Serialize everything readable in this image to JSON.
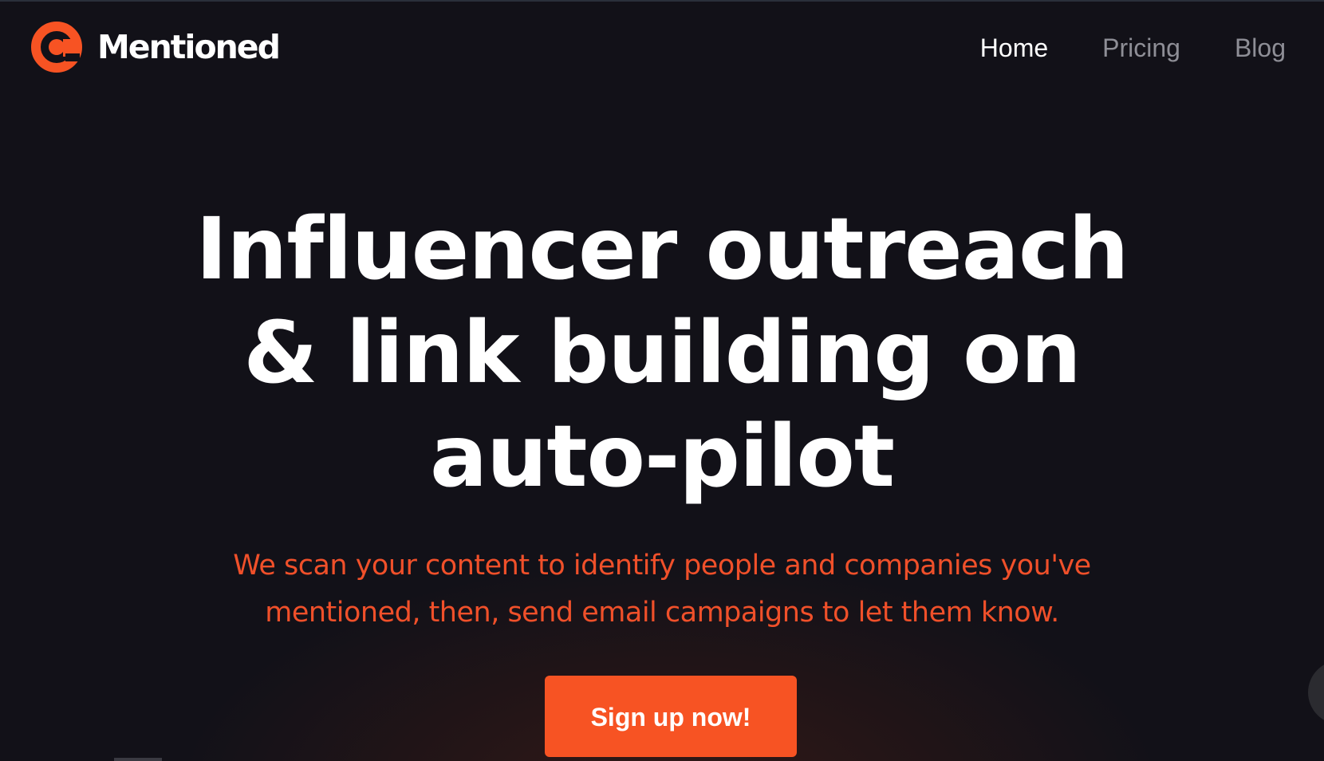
{
  "brand": {
    "name": "Mentioned",
    "logo_icon": "at-sign-icon",
    "accent_color": "#f75323"
  },
  "nav": {
    "items": [
      {
        "label": "Home",
        "active": true
      },
      {
        "label": "Pricing",
        "active": false
      },
      {
        "label": "Blog",
        "active": false
      }
    ]
  },
  "hero": {
    "headline_lines": [
      "Influencer outreach",
      "& link building on",
      "auto-pilot"
    ],
    "subtitle_lines": [
      "We scan your content to identify people and companies you've",
      "mentioned, then, send email campaigns to let them know."
    ],
    "cta_label": "Sign up now!"
  }
}
